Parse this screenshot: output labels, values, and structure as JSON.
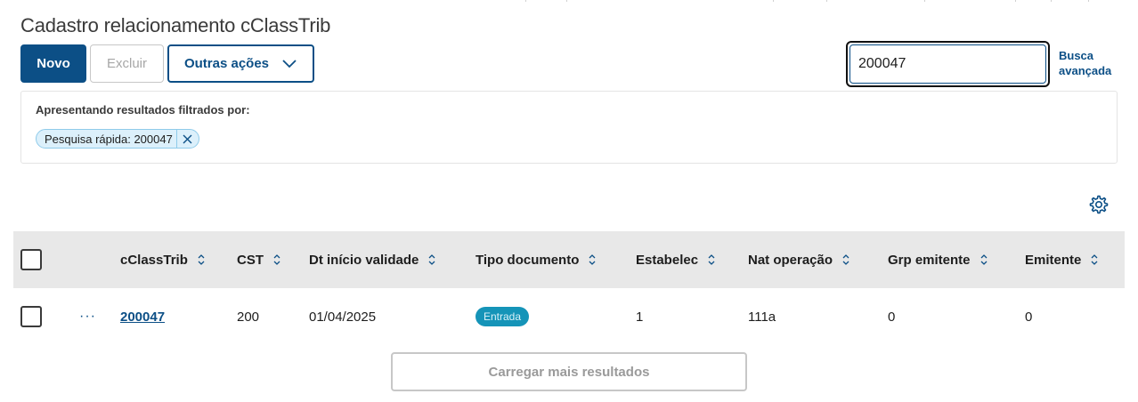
{
  "page": {
    "title": "Cadastro relacionamento cClassTrib"
  },
  "toolbar": {
    "new_label": "Novo",
    "delete_label": "Excluir",
    "other_actions_label": "Outras ações"
  },
  "search": {
    "value": "200047",
    "advanced_label_line1": "Busca",
    "advanced_label_line2": "avançada"
  },
  "filter": {
    "label": "Apresentando resultados filtrados por:",
    "chips": [
      {
        "text": "Pesquisa rápida: 200047"
      }
    ]
  },
  "table": {
    "columns": [
      "cClassTrib",
      "CST",
      "Dt início validade",
      "Tipo documento",
      "Estabelec",
      "Nat operação",
      "Grp emitente",
      "Emitente"
    ],
    "rows": [
      {
        "cclasstrib": "200047",
        "cst": "200",
        "dt_inicio": "01/04/2025",
        "tipo_documento": "Entrada",
        "estabelec": "1",
        "nat_operacao": "111a",
        "grp_emitente": "0",
        "emitente": "0"
      }
    ],
    "row_actions_label": "···"
  },
  "load_more_label": "Carregar mais resultados",
  "colors": {
    "primary": "#0c4f86",
    "badge": "#1594b8",
    "chip_bg": "#dcf0fb",
    "header_bg": "#e8e8e8"
  },
  "icons": [
    "chevron-down-icon",
    "search-icon",
    "close-icon",
    "gear-icon",
    "sort-icon"
  ]
}
